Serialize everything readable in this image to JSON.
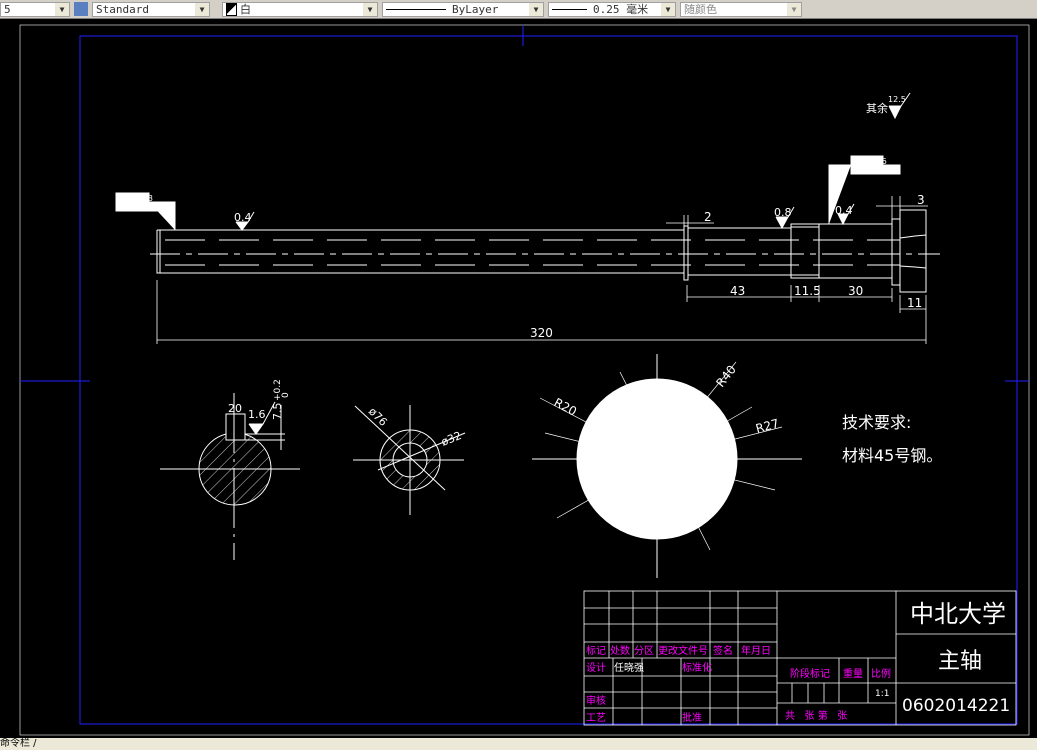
{
  "toolbar": {
    "layer_partial": "5",
    "text_style": "Standard",
    "color": "白",
    "linetype": "ByLayer",
    "lineweight": "0.25 毫米",
    "plot_style": "随颜色"
  },
  "status": {
    "text": "命令栏 /"
  },
  "drawing": {
    "roughness_overall": {
      "label": "其余",
      "value": "12.5"
    },
    "gdt_left": {
      "row1": "0.003",
      "row2_value": "0.01",
      "row2_datum": "A-B"
    },
    "gdt_right": {
      "row1": "0.005",
      "row2_value": "0.006",
      "row2_datum": "A-B"
    },
    "roughness": [
      "0.4",
      "0.8",
      "0.4"
    ],
    "dims": {
      "d2": "2",
      "d3": "3",
      "d43": "43",
      "d115": "11.5",
      "d30": "30",
      "d11": "11",
      "d320": "320"
    },
    "section1": {
      "width": "20",
      "roughness": "1.6",
      "depth": "7.5",
      "tol_upper": "+0.2",
      "tol_lower": "0"
    },
    "section2": {
      "outer": "ø76",
      "inner": "ø32"
    },
    "flange": {
      "r20": "R20",
      "r40": "R40",
      "r27": "R27"
    },
    "tech_title": "技术要求:",
    "tech_text": "材料45号钢。"
  },
  "title_block": {
    "school": "中北大学",
    "part_name": "主轴",
    "drawing_no": "0602014221",
    "headers": [
      "标记",
      "处数",
      "分区",
      "更改文件号",
      "签名",
      "年月日"
    ],
    "design_label": "设计",
    "designer": "任晓强",
    "standard_label": "标准化",
    "review_label": "审核",
    "process_label": "工艺",
    "approve_label": "批准",
    "stage_label": "阶段标记",
    "weight_label": "重量",
    "scale_label": "比例",
    "scale": "1:1",
    "sheets": "共   张 第   张"
  },
  "colors": {
    "lines": "#ffffff",
    "frame": "#0000ff",
    "title_text": "#ff00ff"
  }
}
